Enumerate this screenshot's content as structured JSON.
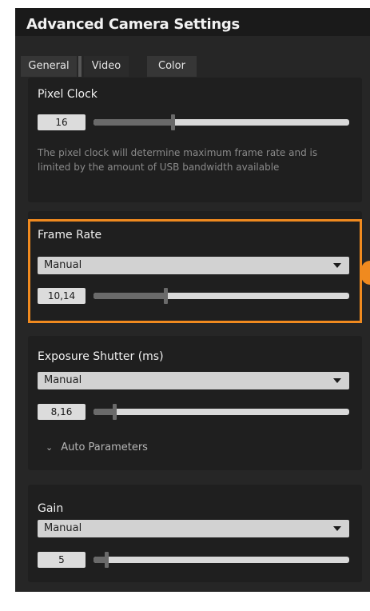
{
  "window": {
    "title": "Advanced Camera Settings"
  },
  "tabs": [
    {
      "label": "General"
    },
    {
      "label": "Video"
    },
    {
      "label": "Color"
    }
  ],
  "pixel_clock": {
    "title": "Pixel Clock",
    "value": "16",
    "slider_fraction": 0.31,
    "help": "The pixel clock will determine maximum frame rate and is limited by the amount of USB bandwidth available"
  },
  "frame_rate": {
    "title": "Frame Rate",
    "mode": "Manual",
    "value": "10,14",
    "slider_fraction": 0.28
  },
  "exposure": {
    "title": "Exposure Shutter (ms)",
    "mode": "Manual",
    "value": "8,16",
    "slider_fraction": 0.08,
    "auto_parameters_label": "Auto Parameters"
  },
  "gain": {
    "title": "Gain",
    "mode": "Manual",
    "value": "5",
    "slider_fraction": 0.05
  },
  "colors": {
    "accent": "#f08a1f",
    "panel_bg": "#262626",
    "card_bg": "#1f1f1f"
  }
}
